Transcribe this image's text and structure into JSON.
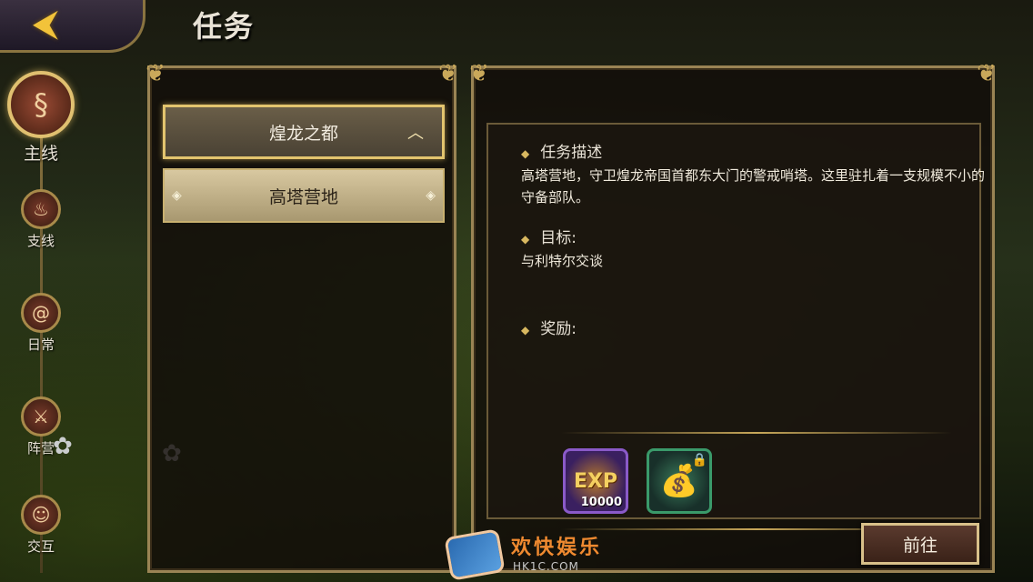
{
  "header": {
    "title": "任务",
    "back_icon": "back-arrow-icon"
  },
  "sidebar": {
    "items": [
      {
        "label": "主线",
        "icon": "scroll-icon",
        "active": true
      },
      {
        "label": "支线",
        "icon": "flame-icon",
        "active": false
      },
      {
        "label": "日常",
        "icon": "swirl-icon",
        "active": false
      },
      {
        "label": "阵营",
        "icon": "crossed-swords-icon",
        "active": false
      },
      {
        "label": "交互",
        "icon": "people-icon",
        "active": false
      }
    ]
  },
  "quest_list": {
    "items": [
      {
        "label": "煌龙之都",
        "state": "expanded"
      },
      {
        "label": "高塔营地",
        "state": "selected-sub"
      }
    ]
  },
  "detail": {
    "description_heading": "任务描述",
    "description_text": "高塔营地，守卫煌龙帝国首都东大门的警戒哨塔。这里驻扎着一支规模不小的守备部队。",
    "goal_heading": "目标:",
    "goal_text": "与利特尔交谈",
    "reward_heading": "奖励:",
    "rewards": [
      {
        "type": "exp",
        "label": "EXP",
        "amount": "10000"
      },
      {
        "type": "gold-bag",
        "locked": true
      }
    ],
    "go_button": "前往"
  },
  "watermark": {
    "text": "欢快娱乐",
    "url": "HK1C.COM"
  },
  "colors": {
    "frame_gold": "#9a8454",
    "panel_bg": "#120e0a",
    "accent_gold": "#e2c46e",
    "exp_border": "#8a5ac8",
    "bag_border": "#3a9a6a"
  }
}
